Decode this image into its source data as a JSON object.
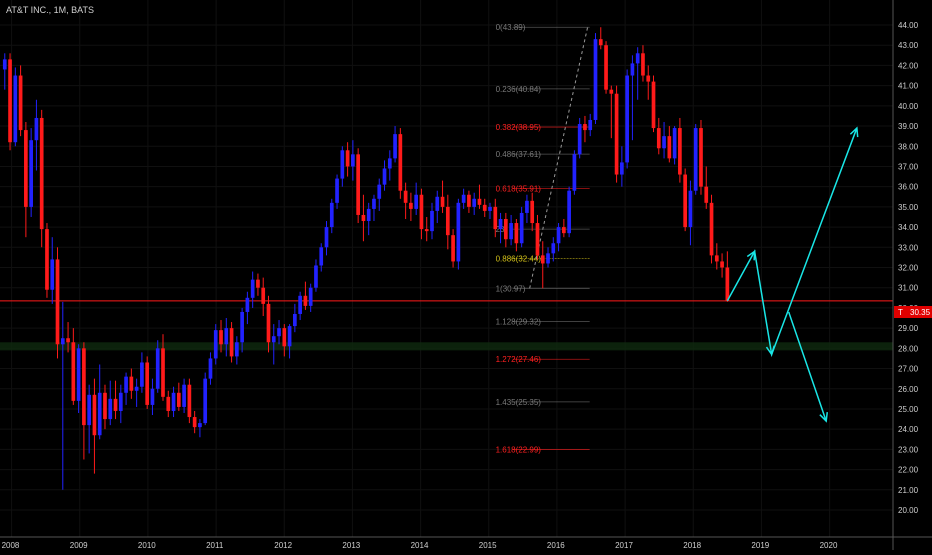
{
  "header": {
    "title": "AT&T INC., 1M, BATS"
  },
  "price_tag": {
    "symbol": "T",
    "value": "30.35"
  },
  "chart_data": {
    "type": "candlestick",
    "symbol": "AT&T INC.",
    "interval": "1M",
    "exchange": "BATS",
    "ylim": [
      20,
      44
    ],
    "y_ticks": [
      "20.00",
      "21.00",
      "22.00",
      "23.00",
      "24.00",
      "25.00",
      "26.00",
      "27.00",
      "28.00",
      "29.00",
      "30.00",
      "31.00",
      "32.00",
      "33.00",
      "34.00",
      "35.00",
      "36.00",
      "37.00",
      "38.00",
      "39.00",
      "40.00",
      "41.00",
      "42.00",
      "43.00",
      "44.00"
    ],
    "x_ticks": [
      {
        "label": "2008",
        "t": 2008.0
      },
      {
        "label": "2009",
        "t": 2009.0
      },
      {
        "label": "2010",
        "t": 2010.0
      },
      {
        "label": "2011",
        "t": 2011.0
      },
      {
        "label": "2012",
        "t": 2012.0
      },
      {
        "label": "2013",
        "t": 2013.0
      },
      {
        "label": "2014",
        "t": 2014.0
      },
      {
        "label": "2015",
        "t": 2015.0
      },
      {
        "label": "2016",
        "t": 2016.0
      },
      {
        "label": "2017",
        "t": 2017.0
      },
      {
        "label": "2018",
        "t": 2018.0
      },
      {
        "label": "2019",
        "t": 2019.0
      },
      {
        "label": "2020",
        "t": 2020.0
      }
    ],
    "current_price": 30.35,
    "colors": {
      "up": "#2222ff",
      "down": "#ff1a1a",
      "fib_gray": "#7a7a7a",
      "fib_red": "#ff2020",
      "fib_yellow": "#d4c21a",
      "projection": "#19e6e6",
      "price_line": "#ff1a1a"
    },
    "candles": [
      {
        "o": 41.8,
        "h": 42.6,
        "l": 40.8,
        "c": 42.3
      },
      {
        "o": 42.3,
        "h": 42.6,
        "l": 37.8,
        "c": 38.2
      },
      {
        "o": 38.2,
        "h": 41.9,
        "l": 38.0,
        "c": 41.5
      },
      {
        "o": 41.5,
        "h": 42.0,
        "l": 38.5,
        "c": 38.8
      },
      {
        "o": 38.8,
        "h": 39.2,
        "l": 33.5,
        "c": 35.0
      },
      {
        "o": 35.0,
        "h": 38.9,
        "l": 34.5,
        "c": 38.3
      },
      {
        "o": 38.3,
        "h": 40.3,
        "l": 36.8,
        "c": 39.4
      },
      {
        "o": 39.4,
        "h": 39.8,
        "l": 33.0,
        "c": 33.9
      },
      {
        "o": 33.9,
        "h": 34.2,
        "l": 30.5,
        "c": 30.9
      },
      {
        "o": 30.9,
        "h": 33.5,
        "l": 30.2,
        "c": 32.4
      },
      {
        "o": 32.4,
        "h": 33.0,
        "l": 27.5,
        "c": 28.2
      },
      {
        "o": 28.2,
        "h": 30.3,
        "l": 21.0,
        "c": 28.5
      },
      {
        "o": 28.5,
        "h": 29.3,
        "l": 27.8,
        "c": 28.3
      },
      {
        "o": 28.3,
        "h": 29.0,
        "l": 25.2,
        "c": 25.4
      },
      {
        "o": 25.4,
        "h": 28.2,
        "l": 24.8,
        "c": 28.0
      },
      {
        "o": 28.0,
        "h": 28.3,
        "l": 22.5,
        "c": 24.2
      },
      {
        "o": 24.2,
        "h": 26.2,
        "l": 22.8,
        "c": 25.7
      },
      {
        "o": 25.7,
        "h": 26.5,
        "l": 21.8,
        "c": 23.7
      },
      {
        "o": 23.7,
        "h": 27.2,
        "l": 23.5,
        "c": 25.8
      },
      {
        "o": 25.8,
        "h": 26.2,
        "l": 24.0,
        "c": 24.5
      },
      {
        "o": 24.5,
        "h": 26.4,
        "l": 24.2,
        "c": 25.5
      },
      {
        "o": 25.5,
        "h": 26.4,
        "l": 24.5,
        "c": 24.9
      },
      {
        "o": 24.9,
        "h": 26.2,
        "l": 24.3,
        "c": 25.8
      },
      {
        "o": 25.8,
        "h": 26.8,
        "l": 25.2,
        "c": 26.6
      },
      {
        "o": 26.6,
        "h": 27.0,
        "l": 25.5,
        "c": 25.9
      },
      {
        "o": 25.9,
        "h": 26.5,
        "l": 25.1,
        "c": 26.1
      },
      {
        "o": 26.1,
        "h": 27.8,
        "l": 25.8,
        "c": 27.3
      },
      {
        "o": 27.3,
        "h": 27.6,
        "l": 25.0,
        "c": 25.2
      },
      {
        "o": 25.2,
        "h": 26.5,
        "l": 24.7,
        "c": 26.0
      },
      {
        "o": 26.0,
        "h": 28.4,
        "l": 25.8,
        "c": 28.0
      },
      {
        "o": 28.0,
        "h": 28.7,
        "l": 25.4,
        "c": 25.6
      },
      {
        "o": 25.6,
        "h": 25.9,
        "l": 24.6,
        "c": 24.9
      },
      {
        "o": 24.9,
        "h": 26.1,
        "l": 24.6,
        "c": 25.8
      },
      {
        "o": 25.8,
        "h": 26.3,
        "l": 24.9,
        "c": 25.1
      },
      {
        "o": 25.1,
        "h": 26.5,
        "l": 24.8,
        "c": 26.2
      },
      {
        "o": 26.2,
        "h": 26.5,
        "l": 24.3,
        "c": 24.6
      },
      {
        "o": 24.6,
        "h": 24.9,
        "l": 23.8,
        "c": 24.1
      },
      {
        "o": 24.1,
        "h": 24.5,
        "l": 23.6,
        "c": 24.3
      },
      {
        "o": 24.3,
        "h": 26.8,
        "l": 24.2,
        "c": 26.5
      },
      {
        "o": 26.5,
        "h": 27.8,
        "l": 26.2,
        "c": 27.5
      },
      {
        "o": 27.5,
        "h": 29.2,
        "l": 27.2,
        "c": 28.9
      },
      {
        "o": 28.9,
        "h": 29.4,
        "l": 27.8,
        "c": 28.2
      },
      {
        "o": 28.2,
        "h": 29.5,
        "l": 27.6,
        "c": 29.0
      },
      {
        "o": 29.0,
        "h": 29.3,
        "l": 27.3,
        "c": 27.6
      },
      {
        "o": 27.6,
        "h": 28.6,
        "l": 27.2,
        "c": 28.3
      },
      {
        "o": 28.3,
        "h": 30.0,
        "l": 27.8,
        "c": 29.8
      },
      {
        "o": 29.8,
        "h": 30.8,
        "l": 29.2,
        "c": 30.5
      },
      {
        "o": 30.5,
        "h": 31.8,
        "l": 30.0,
        "c": 31.4
      },
      {
        "o": 31.4,
        "h": 31.7,
        "l": 30.6,
        "c": 31.0
      },
      {
        "o": 31.0,
        "h": 31.5,
        "l": 29.6,
        "c": 30.2
      },
      {
        "o": 30.2,
        "h": 30.6,
        "l": 27.8,
        "c": 28.3
      },
      {
        "o": 28.3,
        "h": 29.2,
        "l": 27.2,
        "c": 28.6
      },
      {
        "o": 28.6,
        "h": 29.4,
        "l": 28.2,
        "c": 29.0
      },
      {
        "o": 29.0,
        "h": 29.2,
        "l": 27.6,
        "c": 28.1
      },
      {
        "o": 28.1,
        "h": 29.2,
        "l": 27.5,
        "c": 29.1
      },
      {
        "o": 29.1,
        "h": 30.2,
        "l": 28.8,
        "c": 29.7
      },
      {
        "o": 29.7,
        "h": 30.8,
        "l": 29.4,
        "c": 30.6
      },
      {
        "o": 30.6,
        "h": 31.3,
        "l": 29.9,
        "c": 30.1
      },
      {
        "o": 30.1,
        "h": 31.2,
        "l": 29.8,
        "c": 31.0
      },
      {
        "o": 31.0,
        "h": 32.4,
        "l": 30.8,
        "c": 32.1
      },
      {
        "o": 32.1,
        "h": 33.2,
        "l": 31.8,
        "c": 33.0
      },
      {
        "o": 33.0,
        "h": 34.3,
        "l": 32.6,
        "c": 34.0
      },
      {
        "o": 34.0,
        "h": 35.4,
        "l": 33.7,
        "c": 35.2
      },
      {
        "o": 35.2,
        "h": 36.6,
        "l": 34.9,
        "c": 36.4
      },
      {
        "o": 36.4,
        "h": 38.0,
        "l": 36.0,
        "c": 37.8
      },
      {
        "o": 37.8,
        "h": 38.2,
        "l": 36.5,
        "c": 37.0
      },
      {
        "o": 37.0,
        "h": 38.3,
        "l": 36.3,
        "c": 37.6
      },
      {
        "o": 37.6,
        "h": 37.9,
        "l": 34.2,
        "c": 34.6
      },
      {
        "o": 34.6,
        "h": 35.6,
        "l": 33.3,
        "c": 34.3
      },
      {
        "o": 34.3,
        "h": 35.2,
        "l": 33.6,
        "c": 34.9
      },
      {
        "o": 34.9,
        "h": 35.6,
        "l": 34.3,
        "c": 35.4
      },
      {
        "o": 35.4,
        "h": 36.4,
        "l": 34.8,
        "c": 36.1
      },
      {
        "o": 36.1,
        "h": 37.3,
        "l": 35.8,
        "c": 36.9
      },
      {
        "o": 36.9,
        "h": 37.8,
        "l": 36.3,
        "c": 37.4
      },
      {
        "o": 37.4,
        "h": 39.0,
        "l": 37.2,
        "c": 38.6
      },
      {
        "o": 38.6,
        "h": 38.9,
        "l": 35.4,
        "c": 35.8
      },
      {
        "o": 35.8,
        "h": 36.2,
        "l": 34.4,
        "c": 35.2
      },
      {
        "o": 35.2,
        "h": 35.7,
        "l": 34.3,
        "c": 34.9
      },
      {
        "o": 34.9,
        "h": 36.2,
        "l": 34.6,
        "c": 35.6
      },
      {
        "o": 35.6,
        "h": 35.9,
        "l": 33.4,
        "c": 33.9
      },
      {
        "o": 33.9,
        "h": 34.5,
        "l": 33.3,
        "c": 33.8
      },
      {
        "o": 33.8,
        "h": 35.2,
        "l": 33.4,
        "c": 34.8
      },
      {
        "o": 34.8,
        "h": 35.8,
        "l": 34.2,
        "c": 35.5
      },
      {
        "o": 35.5,
        "h": 36.3,
        "l": 34.7,
        "c": 35.0
      },
      {
        "o": 35.0,
        "h": 35.6,
        "l": 32.9,
        "c": 33.6
      },
      {
        "o": 33.6,
        "h": 33.9,
        "l": 32.0,
        "c": 32.3
      },
      {
        "o": 32.3,
        "h": 35.4,
        "l": 31.9,
        "c": 35.2
      },
      {
        "o": 35.2,
        "h": 35.9,
        "l": 34.9,
        "c": 35.6
      },
      {
        "o": 35.6,
        "h": 35.8,
        "l": 34.7,
        "c": 35.0
      },
      {
        "o": 35.0,
        "h": 35.7,
        "l": 34.6,
        "c": 35.4
      },
      {
        "o": 35.4,
        "h": 36.1,
        "l": 34.9,
        "c": 35.1
      },
      {
        "o": 35.1,
        "h": 35.4,
        "l": 34.5,
        "c": 34.8
      },
      {
        "o": 34.8,
        "h": 35.2,
        "l": 34.4,
        "c": 35.0
      },
      {
        "o": 35.0,
        "h": 35.4,
        "l": 33.5,
        "c": 33.9
      },
      {
        "o": 33.9,
        "h": 34.7,
        "l": 33.2,
        "c": 34.4
      },
      {
        "o": 34.4,
        "h": 34.7,
        "l": 33.0,
        "c": 33.4
      },
      {
        "o": 33.4,
        "h": 34.6,
        "l": 33.1,
        "c": 34.2
      },
      {
        "o": 34.2,
        "h": 34.4,
        "l": 32.8,
        "c": 33.2
      },
      {
        "o": 33.2,
        "h": 35.0,
        "l": 33.0,
        "c": 34.7
      },
      {
        "o": 34.7,
        "h": 35.6,
        "l": 34.2,
        "c": 35.3
      },
      {
        "o": 35.3,
        "h": 35.7,
        "l": 33.8,
        "c": 34.2
      },
      {
        "o": 34.2,
        "h": 34.6,
        "l": 32.4,
        "c": 32.6
      },
      {
        "o": 32.6,
        "h": 33.3,
        "l": 30.97,
        "c": 32.2
      },
      {
        "o": 32.2,
        "h": 33.0,
        "l": 32.0,
        "c": 32.7
      },
      {
        "o": 32.7,
        "h": 33.5,
        "l": 32.3,
        "c": 33.2
      },
      {
        "o": 33.2,
        "h": 34.2,
        "l": 32.8,
        "c": 34.0
      },
      {
        "o": 34.0,
        "h": 34.4,
        "l": 33.5,
        "c": 33.7
      },
      {
        "o": 33.7,
        "h": 36.0,
        "l": 33.5,
        "c": 35.8
      },
      {
        "o": 35.8,
        "h": 37.8,
        "l": 35.6,
        "c": 37.6
      },
      {
        "o": 37.6,
        "h": 39.4,
        "l": 37.4,
        "c": 39.1
      },
      {
        "o": 39.1,
        "h": 39.5,
        "l": 38.2,
        "c": 38.8
      },
      {
        "o": 38.8,
        "h": 39.6,
        "l": 38.5,
        "c": 39.3
      },
      {
        "o": 39.3,
        "h": 43.6,
        "l": 39.1,
        "c": 43.3
      },
      {
        "o": 43.3,
        "h": 43.89,
        "l": 42.8,
        "c": 43.0
      },
      {
        "o": 43.0,
        "h": 43.2,
        "l": 40.6,
        "c": 40.8
      },
      {
        "o": 40.8,
        "h": 41.0,
        "l": 38.4,
        "c": 40.6
      },
      {
        "o": 40.6,
        "h": 41.0,
        "l": 36.2,
        "c": 36.6
      },
      {
        "o": 36.6,
        "h": 38.0,
        "l": 36.0,
        "c": 37.2
      },
      {
        "o": 37.2,
        "h": 41.8,
        "l": 36.9,
        "c": 41.5
      },
      {
        "o": 41.5,
        "h": 42.5,
        "l": 38.3,
        "c": 42.1
      },
      {
        "o": 42.1,
        "h": 42.9,
        "l": 40.3,
        "c": 42.6
      },
      {
        "o": 42.6,
        "h": 43.0,
        "l": 41.2,
        "c": 41.5
      },
      {
        "o": 41.5,
        "h": 42.0,
        "l": 40.3,
        "c": 41.2
      },
      {
        "o": 41.2,
        "h": 41.5,
        "l": 38.7,
        "c": 38.9
      },
      {
        "o": 38.9,
        "h": 39.4,
        "l": 37.6,
        "c": 37.9
      },
      {
        "o": 37.9,
        "h": 39.2,
        "l": 37.4,
        "c": 38.5
      },
      {
        "o": 38.5,
        "h": 39.0,
        "l": 37.2,
        "c": 37.4
      },
      {
        "o": 37.4,
        "h": 39.0,
        "l": 37.1,
        "c": 38.9
      },
      {
        "o": 38.9,
        "h": 39.4,
        "l": 36.2,
        "c": 36.6
      },
      {
        "o": 36.6,
        "h": 36.9,
        "l": 33.8,
        "c": 34.0
      },
      {
        "o": 34.0,
        "h": 36.3,
        "l": 33.1,
        "c": 35.8
      },
      {
        "o": 35.8,
        "h": 39.1,
        "l": 35.6,
        "c": 38.9
      },
      {
        "o": 38.9,
        "h": 39.3,
        "l": 35.6,
        "c": 36.0
      },
      {
        "o": 36.0,
        "h": 37.0,
        "l": 34.9,
        "c": 35.2
      },
      {
        "o": 35.2,
        "h": 35.6,
        "l": 32.2,
        "c": 32.6
      },
      {
        "o": 32.6,
        "h": 33.2,
        "l": 31.9,
        "c": 32.3
      },
      {
        "o": 32.3,
        "h": 32.7,
        "l": 31.5,
        "c": 32.0
      },
      {
        "o": 32.0,
        "h": 32.8,
        "l": 30.3,
        "c": 30.35
      }
    ],
    "fib_levels": [
      {
        "label": "0(43.89)",
        "value": 43.89,
        "color": "gray"
      },
      {
        "label": "0.236(40.84)",
        "value": 40.84,
        "color": "gray"
      },
      {
        "label": "0.382(38.95)",
        "value": 38.95,
        "color": "red"
      },
      {
        "label": "0.486(37.61)",
        "value": 37.61,
        "color": "gray"
      },
      {
        "label": "0.618(35.91)",
        "value": 35.91,
        "color": "red"
      },
      {
        "label": "23)",
        "value": 33.9,
        "color": "gray"
      },
      {
        "label": "0.886(32.44)",
        "value": 32.44,
        "color": "yellow"
      },
      {
        "label": "1(30.97)",
        "value": 30.97,
        "color": "gray"
      },
      {
        "label": "1.128(29.32)",
        "value": 29.32,
        "color": "gray"
      },
      {
        "label": "1.272(27.46)",
        "value": 27.46,
        "color": "red"
      },
      {
        "label": "1.435(25.35)",
        "value": 25.35,
        "color": "gray"
      },
      {
        "label": "1.618(22.99)",
        "value": 22.99,
        "color": "red"
      }
    ],
    "support_zone": [
      27.9,
      28.3
    ],
    "projection_points": [
      {
        "t": 2018.5,
        "p": 30.35
      },
      {
        "t": 2018.9,
        "p": 32.8
      },
      {
        "t": 2019.15,
        "p": 27.7
      },
      {
        "t": 2020.4,
        "p": 38.9
      }
    ],
    "projection_branch": [
      {
        "t": 2019.4,
        "p": 29.8
      },
      {
        "t": 2019.95,
        "p": 24.4
      }
    ],
    "fib_anchor_line": [
      {
        "t": 2015.6,
        "p": 30.97
      },
      {
        "t": 2016.45,
        "p": 43.89
      }
    ]
  }
}
